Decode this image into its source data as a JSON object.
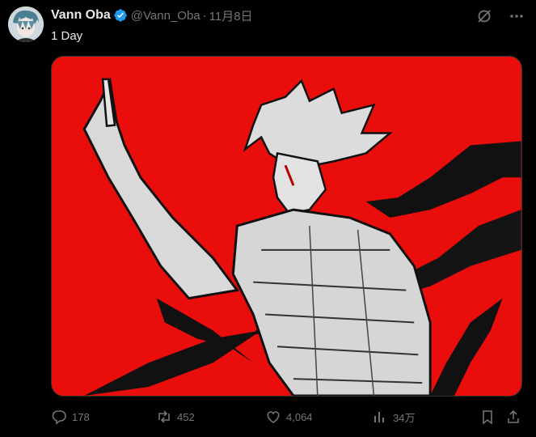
{
  "post": {
    "display_name": "Vann Oba",
    "handle": "@Vann_Oba",
    "separator": "·",
    "date": "11月8日",
    "text": "1 Day",
    "verified": true,
    "avatar_icon": "avatar-portrait",
    "media_icon": "artwork-illustration"
  },
  "metrics": {
    "replies": "178",
    "reposts": "452",
    "likes": "4,064",
    "views": "34万"
  },
  "colors": {
    "background": "#000000",
    "text": "#e7e9ea",
    "muted": "#71767b",
    "verified": "#1d9bf0",
    "media_bg": "#e90e0b"
  },
  "icons": {
    "grok": "grok-icon",
    "more": "more-icon",
    "reply": "reply-icon",
    "repost": "repost-icon",
    "like": "heart-icon",
    "views": "views-icon",
    "bookmark": "bookmark-icon",
    "share": "share-icon"
  }
}
